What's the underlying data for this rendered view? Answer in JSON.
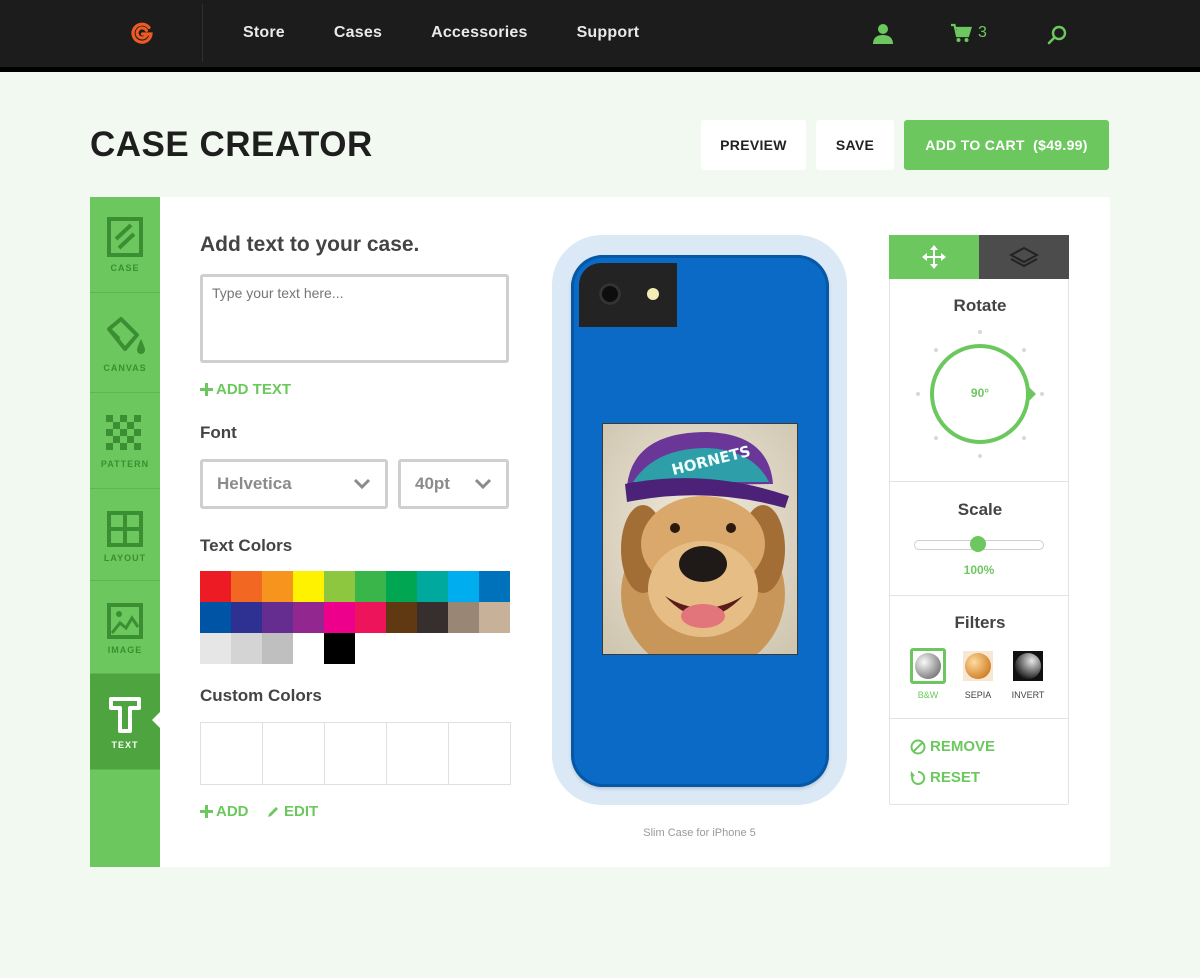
{
  "nav": {
    "links": [
      "Store",
      "Cases",
      "Accessories",
      "Support"
    ],
    "cart_count": "3"
  },
  "header": {
    "title": "CASE CREATOR",
    "preview_label": "PREVIEW",
    "save_label": "SAVE",
    "add_to_cart_label": "ADD TO CART  ($49.99)"
  },
  "sidebar": {
    "items": [
      {
        "label": "CASE",
        "icon": "case-icon"
      },
      {
        "label": "CANVAS",
        "icon": "paint-bucket-icon"
      },
      {
        "label": "PATTERN",
        "icon": "checker-pattern-icon"
      },
      {
        "label": "LAYOUT",
        "icon": "grid-layout-icon"
      },
      {
        "label": "IMAGE",
        "icon": "image-icon"
      },
      {
        "label": "TEXT",
        "icon": "text-icon"
      }
    ],
    "active": "TEXT"
  },
  "text_panel": {
    "heading": "Add text to your case.",
    "placeholder": "Type your text here...",
    "add_text_label": "ADD TEXT",
    "font_label": "Font",
    "font_value": "Helvetica",
    "size_value": "40pt",
    "text_colors_label": "Text Colors",
    "custom_colors_label": "Custom Colors",
    "add_label": "ADD",
    "edit_label": "EDIT"
  },
  "palette": [
    "#ed1c24",
    "#f26722",
    "#f7941d",
    "#fff200",
    "#8dc63f",
    "#39b54a",
    "#00a651",
    "#00a99d",
    "#00aeef",
    "#0072bc",
    "#0054a6",
    "#2e3192",
    "#662d91",
    "#92278f",
    "#ec008c",
    "#ed145b",
    "#603913",
    "#362f2d",
    "#998675",
    "#c7b299",
    "#e6e6e6",
    "#d4d4d4",
    "#bfbfbf",
    "#ffffff",
    "#000000"
  ],
  "preview": {
    "caption": "Slim Case for iPhone 5",
    "case_color": "#0a6ac6"
  },
  "tools": {
    "rotate_label": "Rotate",
    "rotate_value": "90°",
    "scale_label": "Scale",
    "scale_value": "100%",
    "filters_label": "Filters",
    "filters": [
      {
        "label": "B&W",
        "selected": true
      },
      {
        "label": "SEPIA",
        "selected": false
      },
      {
        "label": "INVERT",
        "selected": false
      }
    ],
    "remove_label": "REMOVE",
    "reset_label": "RESET"
  },
  "colors": {
    "accent": "#6cc85e",
    "nav_bg": "#1c1c1c",
    "logo": "#ef5a24"
  }
}
